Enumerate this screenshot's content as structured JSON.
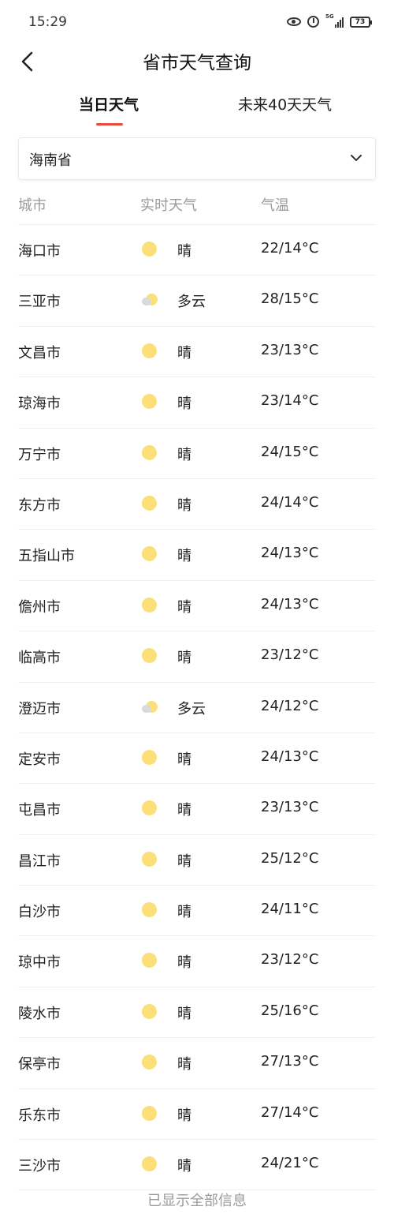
{
  "status_bar": {
    "time": "15:29",
    "network": "5G",
    "battery": "73"
  },
  "header": {
    "title": "省市天气查询"
  },
  "tabs": [
    {
      "label": "当日天气",
      "active": true
    },
    {
      "label": "未来40天天气",
      "active": false
    }
  ],
  "province_select": {
    "value": "海南省"
  },
  "table": {
    "headers": {
      "city": "城市",
      "weather": "实时天气",
      "temp": "气温"
    },
    "rows": [
      {
        "city": "海口市",
        "icon": "sun-icon",
        "weather": "晴",
        "temp": "22/14°C"
      },
      {
        "city": "三亚市",
        "icon": "partly-cloudy-icon",
        "weather": "多云",
        "temp": "28/15°C"
      },
      {
        "city": "文昌市",
        "icon": "sun-icon",
        "weather": "晴",
        "temp": "23/13°C"
      },
      {
        "city": "琼海市",
        "icon": "sun-icon",
        "weather": "晴",
        "temp": "23/14°C"
      },
      {
        "city": "万宁市",
        "icon": "sun-icon",
        "weather": "晴",
        "temp": "24/15°C"
      },
      {
        "city": "东方市",
        "icon": "sun-icon",
        "weather": "晴",
        "temp": "24/14°C"
      },
      {
        "city": "五指山市",
        "icon": "sun-icon",
        "weather": "晴",
        "temp": "24/13°C"
      },
      {
        "city": "儋州市",
        "icon": "sun-icon",
        "weather": "晴",
        "temp": "24/13°C"
      },
      {
        "city": "临高市",
        "icon": "sun-icon",
        "weather": "晴",
        "temp": "23/12°C"
      },
      {
        "city": "澄迈市",
        "icon": "partly-cloudy-icon",
        "weather": "多云",
        "temp": "24/12°C"
      },
      {
        "city": "定安市",
        "icon": "sun-icon",
        "weather": "晴",
        "temp": "24/13°C"
      },
      {
        "city": "屯昌市",
        "icon": "sun-icon",
        "weather": "晴",
        "temp": "23/13°C"
      },
      {
        "city": "昌江市",
        "icon": "sun-icon",
        "weather": "晴",
        "temp": "25/12°C"
      },
      {
        "city": "白沙市",
        "icon": "sun-icon",
        "weather": "晴",
        "temp": "24/11°C"
      },
      {
        "city": "琼中市",
        "icon": "sun-icon",
        "weather": "晴",
        "temp": "23/12°C"
      },
      {
        "city": "陵水市",
        "icon": "sun-icon",
        "weather": "晴",
        "temp": "25/16°C"
      },
      {
        "city": "保亭市",
        "icon": "sun-icon",
        "weather": "晴",
        "temp": "27/13°C"
      },
      {
        "city": "乐东市",
        "icon": "sun-icon",
        "weather": "晴",
        "temp": "27/14°C"
      },
      {
        "city": "三沙市",
        "icon": "sun-icon",
        "weather": "晴",
        "temp": "24/21°C"
      }
    ]
  },
  "footer": {
    "text": "已显示全部信息"
  },
  "colors": {
    "accent": "#e84a3d",
    "sun": "#fbe079",
    "cloud": "#d7dbe0",
    "muted": "#9a9a9a"
  }
}
